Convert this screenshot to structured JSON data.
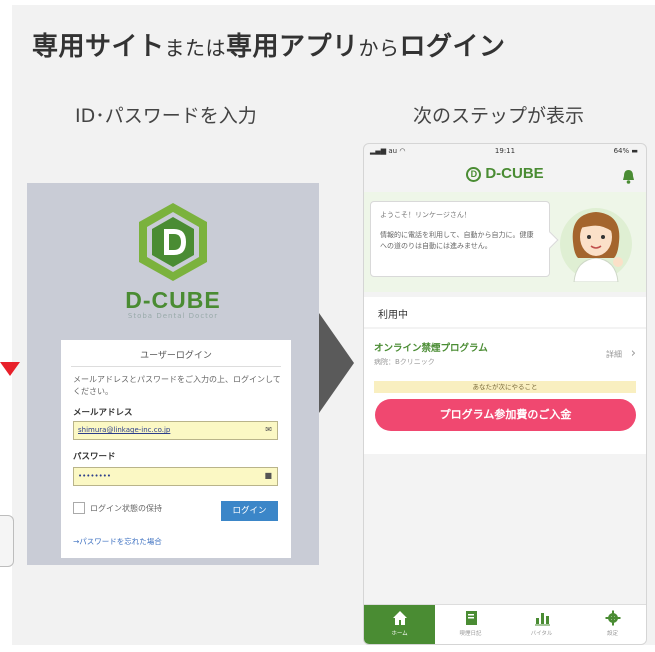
{
  "headline": {
    "part1": "専用サイト",
    "part2": "または",
    "part3": "専用アプリ",
    "part4": "から",
    "part5": "ログイン"
  },
  "steps": {
    "left_label": "ID･パスワードを入力",
    "right_label": "次のステップが表示"
  },
  "login": {
    "logo_text": "D-CUBE",
    "logo_sub": "Stoba Dental Doctor",
    "card_title": "ユーザーログイン",
    "description": "メールアドレスとパスワードをご入力の上、ログインしてください。",
    "email_label": "メールアドレス",
    "email_value": "shimura@linkage-inc.co.jp",
    "password_label": "パスワード",
    "password_value": "••••••••",
    "remember_label": "ログイン状態の保持",
    "login_button": "ログイン",
    "forgot_link": "→パスワードを忘れた場合"
  },
  "phone": {
    "status": {
      "carrier": "au",
      "time": "19:11",
      "battery": "64%"
    },
    "app_title": "D-CUBE",
    "greeting_title": "ようこそ！リンケージさん！",
    "greeting_body": "情報的に電話を利用して、自動から自力に。健康への道のりは自動には進みません。",
    "section_title": "利用中",
    "program_title": "オンライン禁煙プログラム",
    "program_sub": "病院：Bクリニック",
    "detail_label": "詳細",
    "todo_label": "あなたが次にやること",
    "pay_button": "プログラム参加費のご入金",
    "tabs": [
      {
        "label": "ホーム",
        "icon": "home-icon"
      },
      {
        "label": "喫煙日記",
        "icon": "diary-icon"
      },
      {
        "label": "バイタル",
        "icon": "chart-icon"
      },
      {
        "label": "設定",
        "icon": "gear-icon"
      }
    ]
  },
  "colors": {
    "brand_green": "#4a8c33",
    "pay_pink": "#f04870",
    "login_blue": "#3b86c8",
    "alert_red": "#e8202a"
  }
}
